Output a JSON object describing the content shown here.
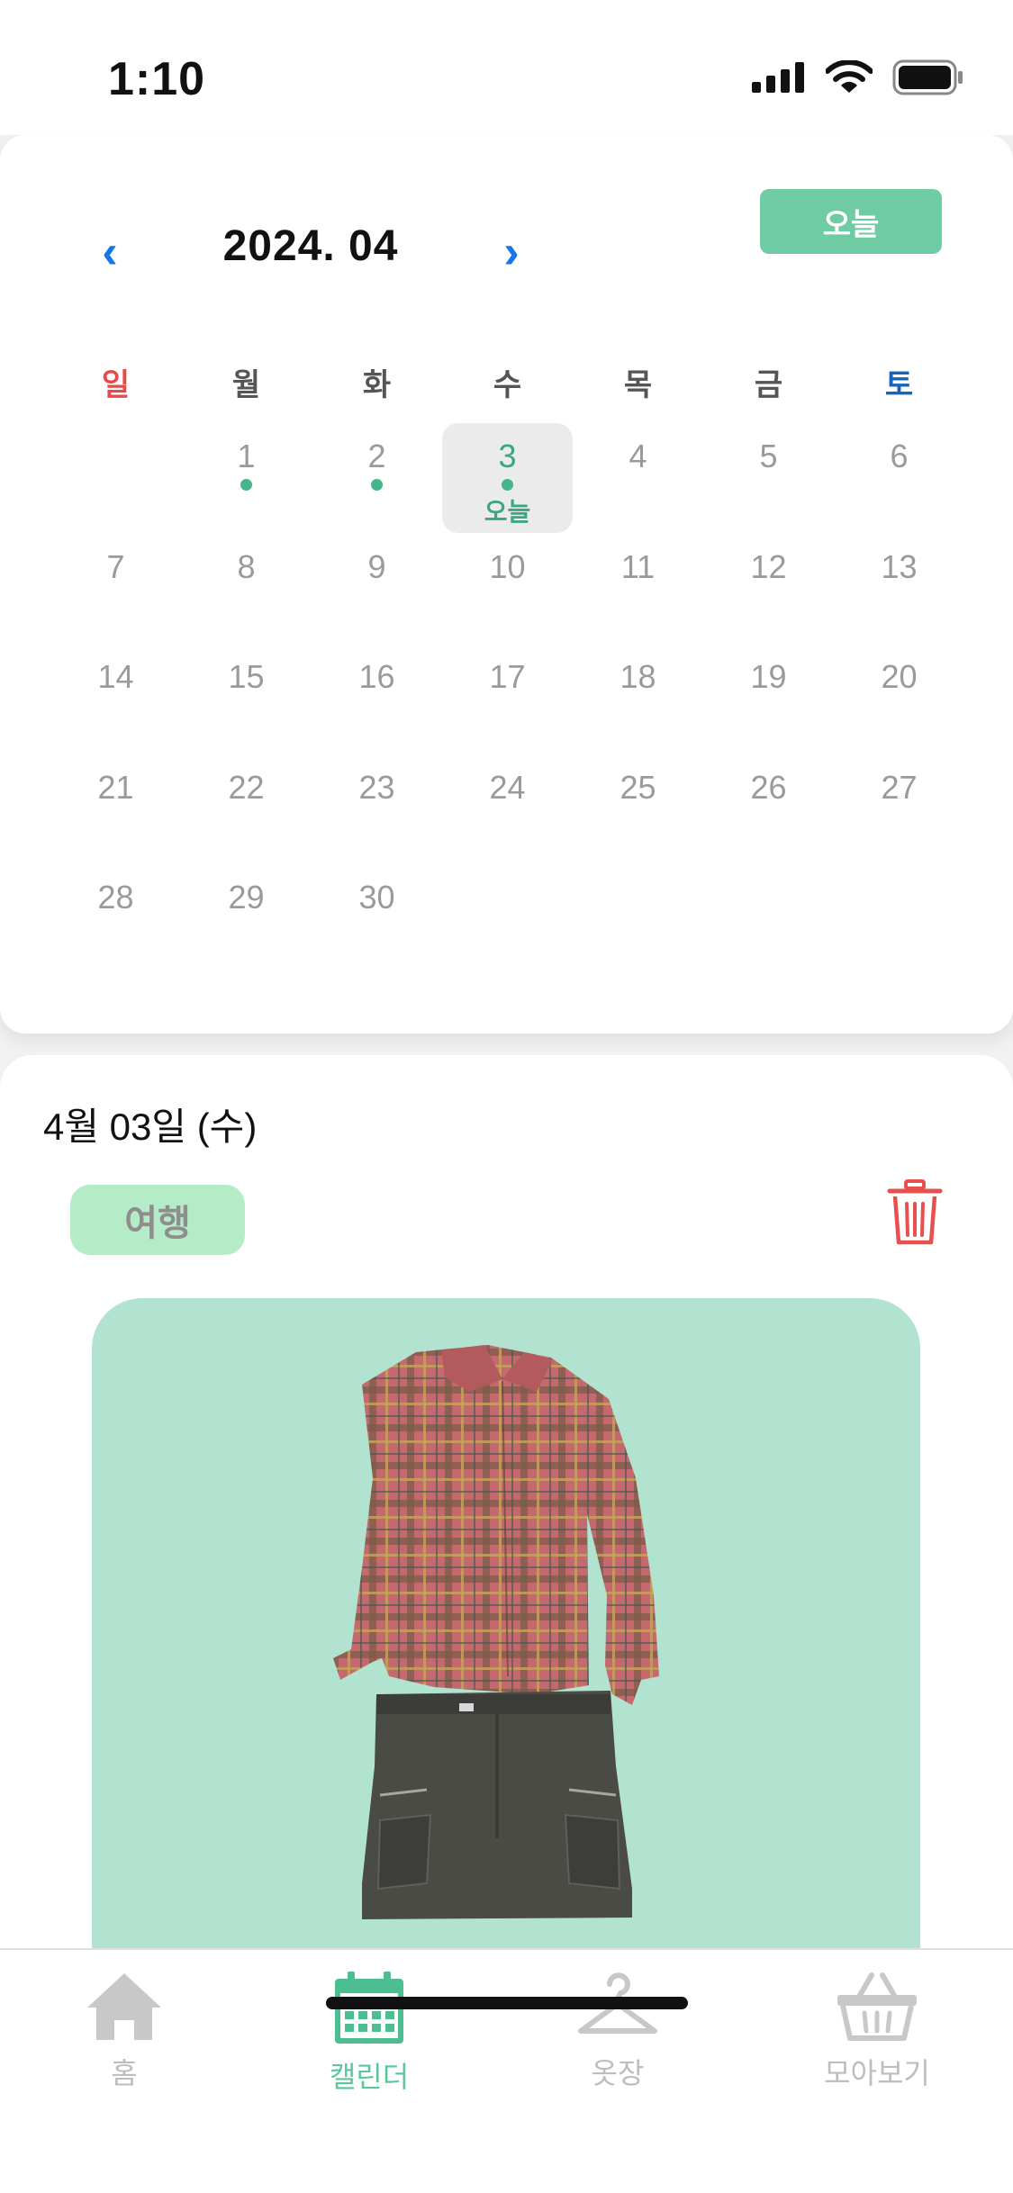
{
  "status_bar": {
    "time": "1:10"
  },
  "calendar": {
    "month_title": "2024. 04",
    "prev_glyph": "‹",
    "next_glyph": "›",
    "today_button": "오늘",
    "weekdays": [
      "일",
      "월",
      "화",
      "수",
      "목",
      "금",
      "토"
    ],
    "weekday_colors": {
      "sunday": "#e84a4a",
      "saturday": "#1565c0",
      "default": "#555555"
    },
    "days": [
      "1",
      "2",
      "3",
      "4",
      "5",
      "6",
      "7",
      "8",
      "9",
      "10",
      "11",
      "12",
      "13",
      "14",
      "15",
      "16",
      "17",
      "18",
      "19",
      "20",
      "21",
      "22",
      "23",
      "24",
      "25",
      "26",
      "27",
      "28",
      "29",
      "30"
    ],
    "days_with_entry": [
      "1",
      "2",
      "3"
    ],
    "selected_day": "3",
    "selected_day_label": "오늘",
    "first_weekday_index": 1,
    "accent_color": "#6ecba3"
  },
  "detail": {
    "date_label": "4월 03일 (수)",
    "tag": "여행",
    "delete_icon": "trash-icon",
    "outfit_items": [
      "plaid-shirt-image",
      "cargo-skirt-image"
    ]
  },
  "tab_bar": {
    "items": [
      {
        "label": "홈",
        "icon": "home-icon",
        "active": false
      },
      {
        "label": "캘린더",
        "icon": "calendar-icon",
        "active": true
      },
      {
        "label": "옷장",
        "icon": "hanger-icon",
        "active": false
      },
      {
        "label": "모아보기",
        "icon": "basket-icon",
        "active": false
      }
    ]
  }
}
